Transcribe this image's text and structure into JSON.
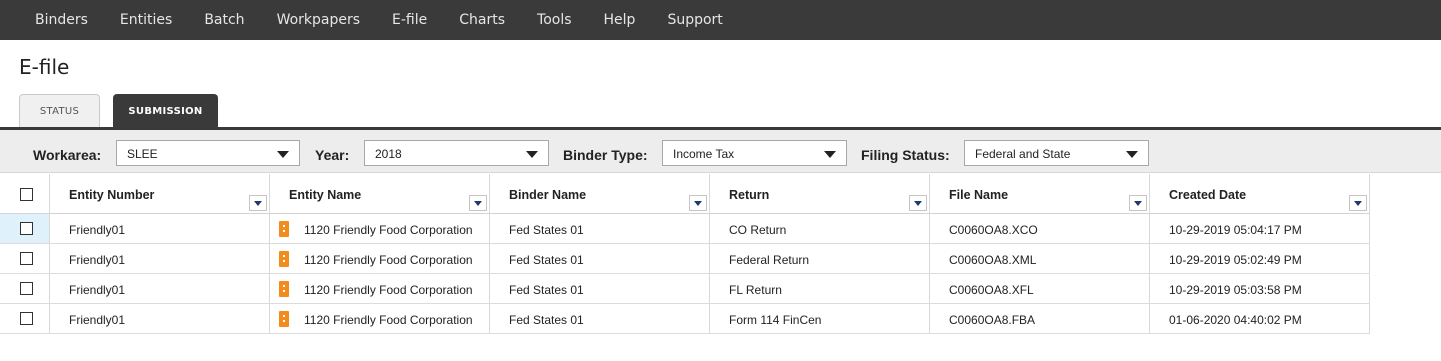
{
  "nav": {
    "items": [
      "Binders",
      "Entities",
      "Batch",
      "Workpapers",
      "E-file",
      "Charts",
      "Tools",
      "Help",
      "Support"
    ]
  },
  "page": {
    "title": "E-file"
  },
  "tabs": [
    {
      "label": "STATUS",
      "active": false
    },
    {
      "label": "SUBMISSION",
      "active": true
    }
  ],
  "filters": {
    "workarea": {
      "label": "Workarea:",
      "value": "SLEE"
    },
    "year": {
      "label": "Year:",
      "value": "2018"
    },
    "binder_type": {
      "label": "Binder Type:",
      "value": "Income Tax"
    },
    "filing_status": {
      "label": "Filing Status:",
      "value": "Federal and State"
    }
  },
  "table": {
    "columns": [
      "Entity Number",
      "Entity Name",
      "Binder Name",
      "Return",
      "File Name",
      "Created Date"
    ],
    "rows": [
      {
        "entity_number": "Friendly01",
        "entity_name": "1120 Friendly Food Corporation",
        "binder_name": "Fed States 01",
        "return": "CO Return",
        "file_name": "C0060OA8.XCO",
        "created_date": "10-29-2019 05:04:17 PM"
      },
      {
        "entity_number": "Friendly01",
        "entity_name": "1120 Friendly Food Corporation",
        "binder_name": "Fed States 01",
        "return": "Federal Return",
        "file_name": "C0060OA8.XML",
        "created_date": "10-29-2019 05:02:49 PM"
      },
      {
        "entity_number": "Friendly01",
        "entity_name": "1120 Friendly Food Corporation",
        "binder_name": "Fed States 01",
        "return": "FL Return",
        "file_name": "C0060OA8.XFL",
        "created_date": "10-29-2019 05:03:58 PM"
      },
      {
        "entity_number": "Friendly01",
        "entity_name": "1120 Friendly Food Corporation",
        "binder_name": "Fed States 01",
        "return": "Form 114 FinCen",
        "file_name": "C0060OA8.FBA",
        "created_date": "01-06-2020 04:40:02 PM"
      }
    ]
  },
  "colors": {
    "nav_bg": "#3a3a3a",
    "filter_bg": "#ededed",
    "entity_icon": "#f28c1c",
    "selected_cell": "#dff1fa"
  }
}
